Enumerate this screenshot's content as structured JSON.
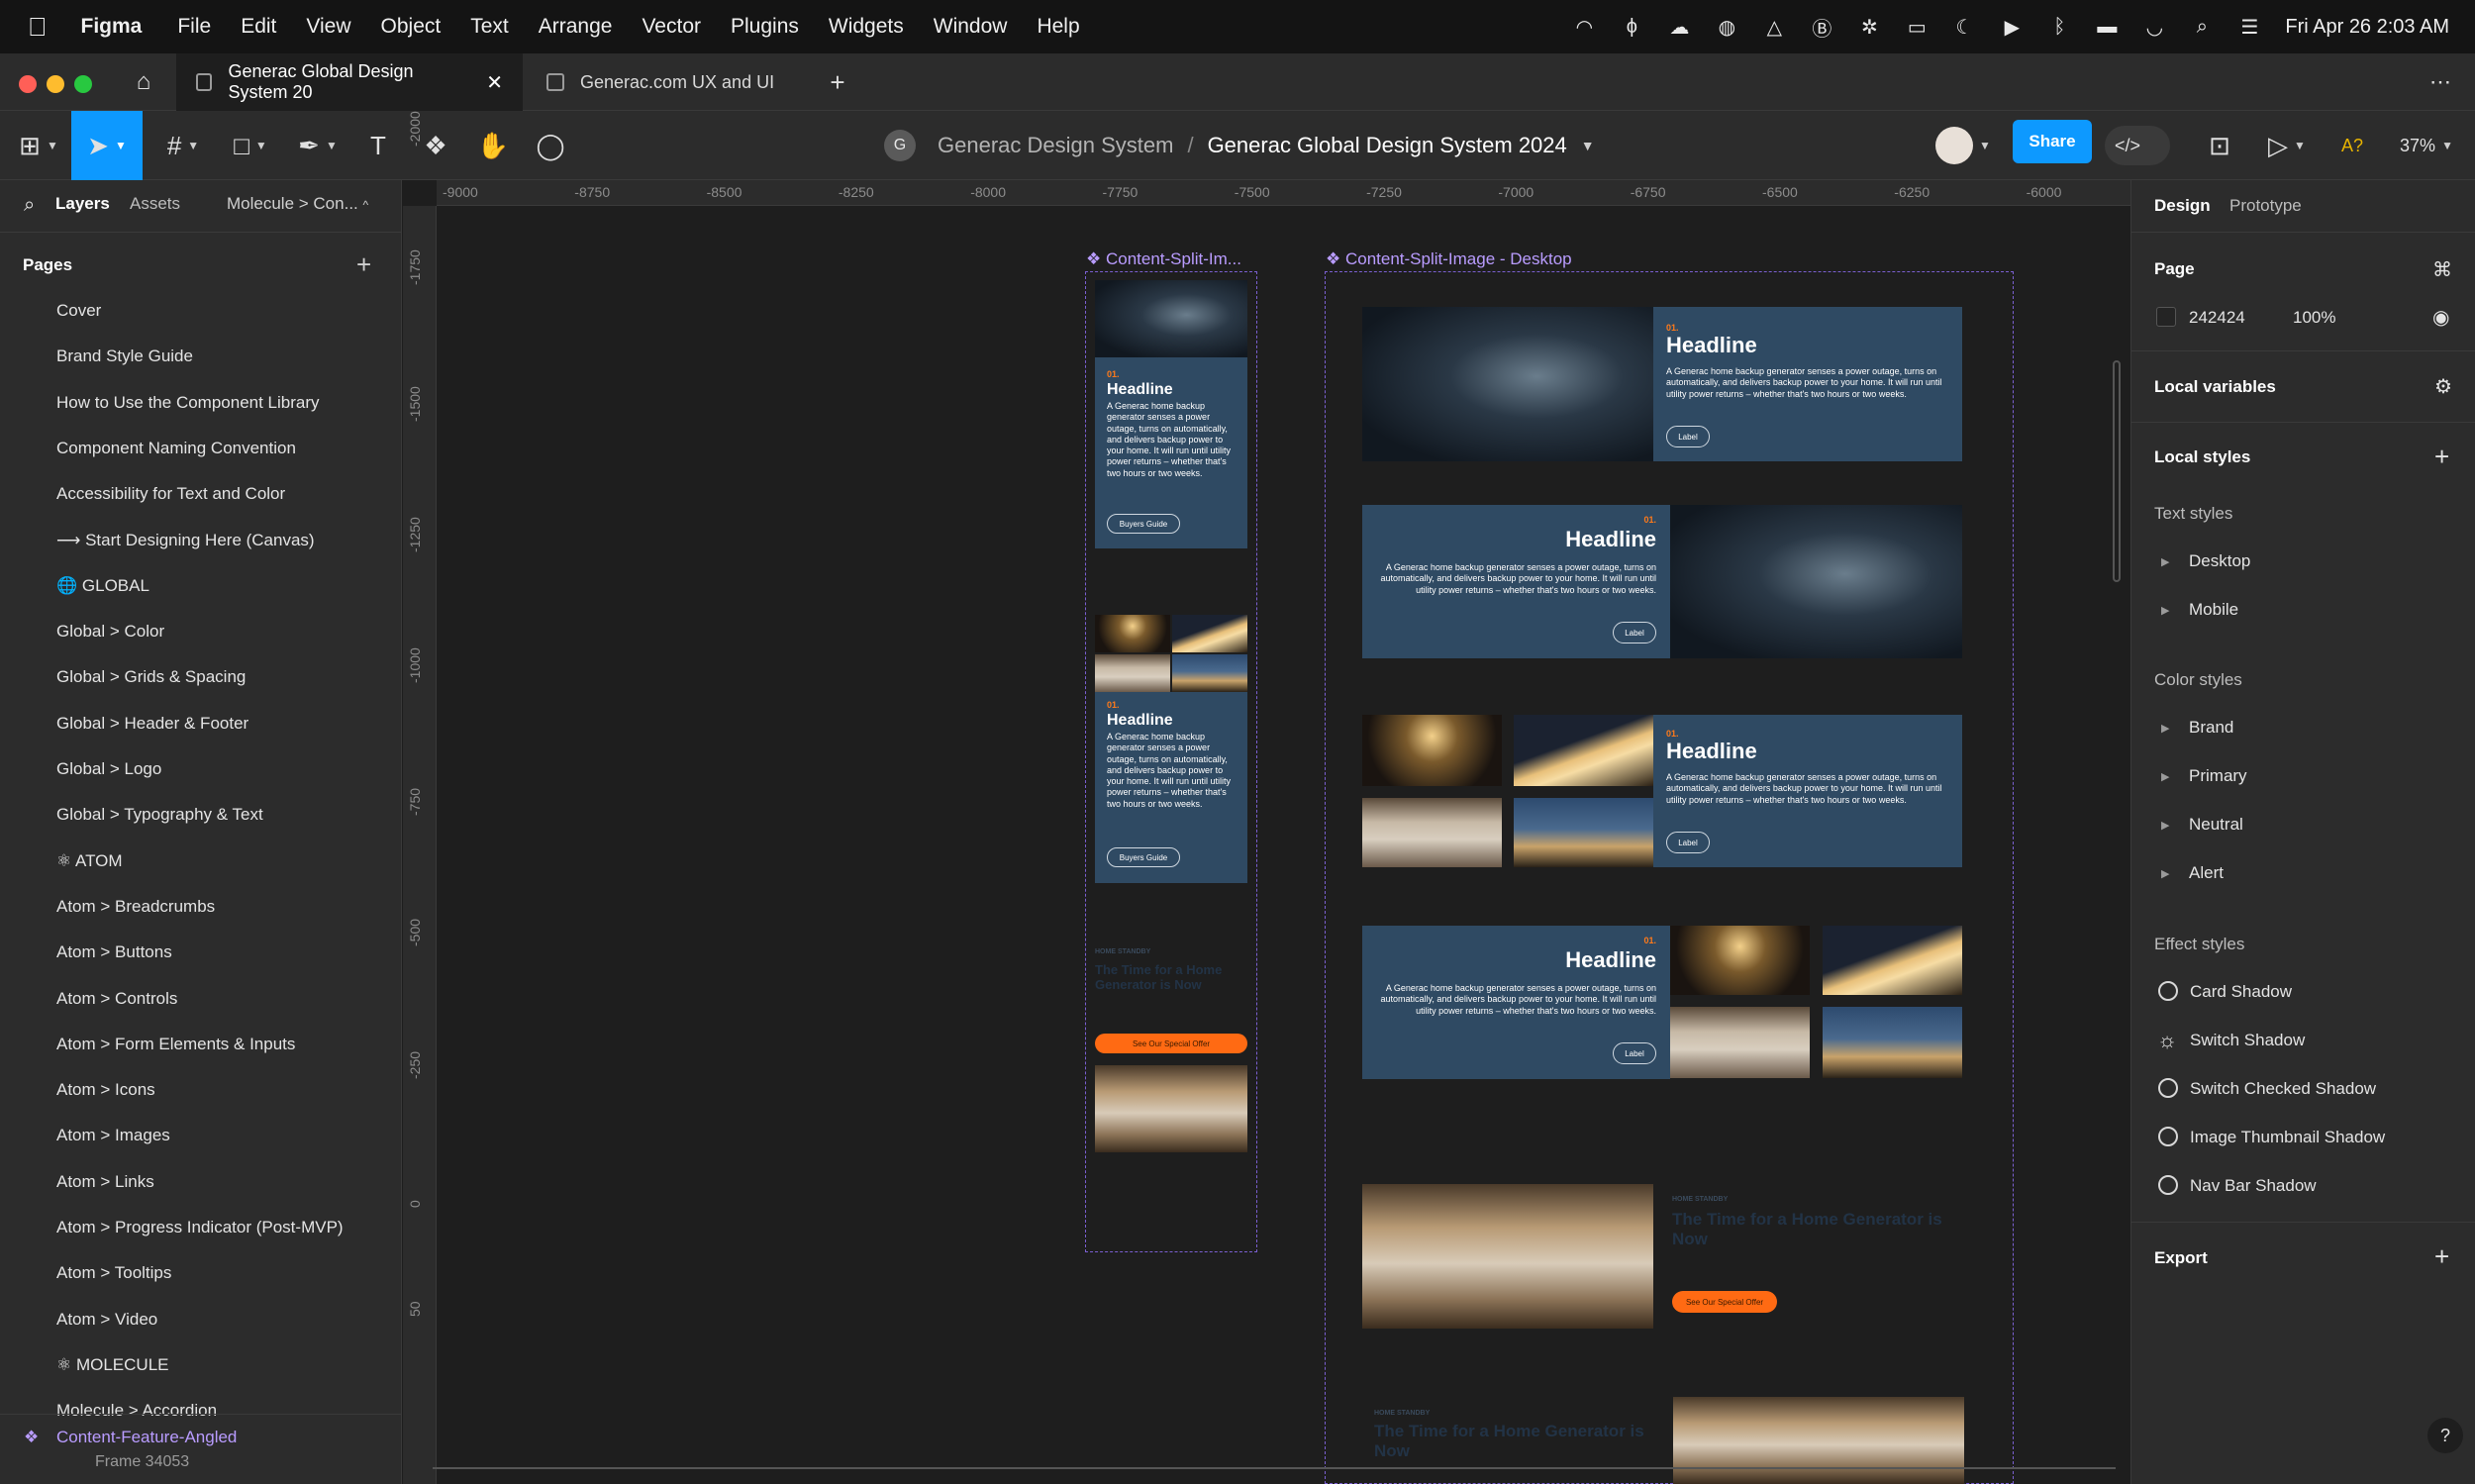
{
  "menubar": {
    "app": "Figma",
    "menus": [
      "File",
      "Edit",
      "View",
      "Object",
      "Text",
      "Arrange",
      "Vector",
      "Plugins",
      "Widgets",
      "Window",
      "Help"
    ],
    "clock": "Fri Apr 26  2:03 AM"
  },
  "tabs": [
    {
      "label": "Generac Global Design System 20"
    },
    {
      "label": "Generac.com UX and UI"
    }
  ],
  "toolbar": {
    "project": "Generac Design System",
    "separator": "/",
    "file": "Generac Global Design System 2024",
    "share": "Share",
    "zoom": "37%",
    "avatar_initial": "G"
  },
  "left": {
    "tab_layers": "Layers",
    "tab_assets": "Assets",
    "page_selector": "Molecule > Con...",
    "pages_title": "Pages",
    "pages": [
      "Cover",
      "Brand Style Guide",
      "How to Use the Component Library",
      "Component Naming Convention",
      "Accessibility for Text and Color",
      "⟶ Start Designing Here (Canvas)",
      "🌐 GLOBAL",
      "Global > Color",
      "Global > Grids & Spacing",
      "Global > Header & Footer",
      "Global > Logo",
      "Global > Typography & Text",
      "⚛ ATOM",
      "Atom > Breadcrumbs",
      "Atom > Buttons",
      "Atom > Controls",
      "Atom > Form Elements & Inputs",
      "Atom > Icons",
      "Atom > Images",
      "Atom > Links",
      "Atom > Progress Indicator (Post-MVP)",
      "Atom > Tooltips",
      "Atom > Video",
      "⚛ MOLECULE",
      "Molecule > Accordion"
    ],
    "layer": "Content-Feature-Angled",
    "layer_sub": "Frame 34053"
  },
  "rulers": {
    "h": [
      "-9000",
      "-8750",
      "-8500",
      "-8250",
      "-8000",
      "-7750",
      "-7500",
      "-7250",
      "-7000",
      "-6750",
      "-6500",
      "-6250",
      "-6000"
    ],
    "v": [
      "-2000",
      "-1750",
      "-1500",
      "-1250",
      "-1000",
      "-750",
      "-500",
      "-250",
      "0",
      "50"
    ]
  },
  "canvas": {
    "frame_mobile": "❖ Content-Split-Im...",
    "frame_desktop": "❖ Content-Split-Image - Desktop",
    "num": "01.",
    "headline": "Headline",
    "body_mobile": "A Generac home backup generator senses a power outage, turns on automatically, and delivers backup power to your home. It will run until utility power returns – whether that's two hours or two weeks.",
    "body_desktop": "A Generac home backup generator senses a power outage, turns on automatically, and delivers backup power to your home. It will run until utility power returns – whether that's two hours or two weeks.",
    "btn_mobile": "Buyers Guide",
    "btn_desktop": "Label",
    "eyebrow": "HOME STANDBY",
    "offer": "See Our Special Offer",
    "dark_headline": "The Time for a Home Generator is Now"
  },
  "right": {
    "tab_design": "Design",
    "tab_prototype": "Prototype",
    "page_label": "Page",
    "page_color": "242424",
    "page_opacity": "100%",
    "local_variables": "Local variables",
    "local_styles": "Local styles",
    "text_styles": "Text styles",
    "text_items": [
      "Desktop",
      "Mobile"
    ],
    "color_styles": "Color styles",
    "color_items": [
      "Brand",
      "Primary",
      "Neutral",
      "Alert"
    ],
    "effect_styles": "Effect styles",
    "effect_items": [
      "Card Shadow",
      "Switch Shadow",
      "Switch Checked Shadow",
      "Image Thumbnail Shadow",
      "Nav Bar Shadow"
    ],
    "export": "Export",
    "help": "?"
  },
  "colors": {
    "accent": "#0d99ff",
    "card": "#2f4a63",
    "orange": "#ff6a13",
    "component": "#b99cff"
  }
}
